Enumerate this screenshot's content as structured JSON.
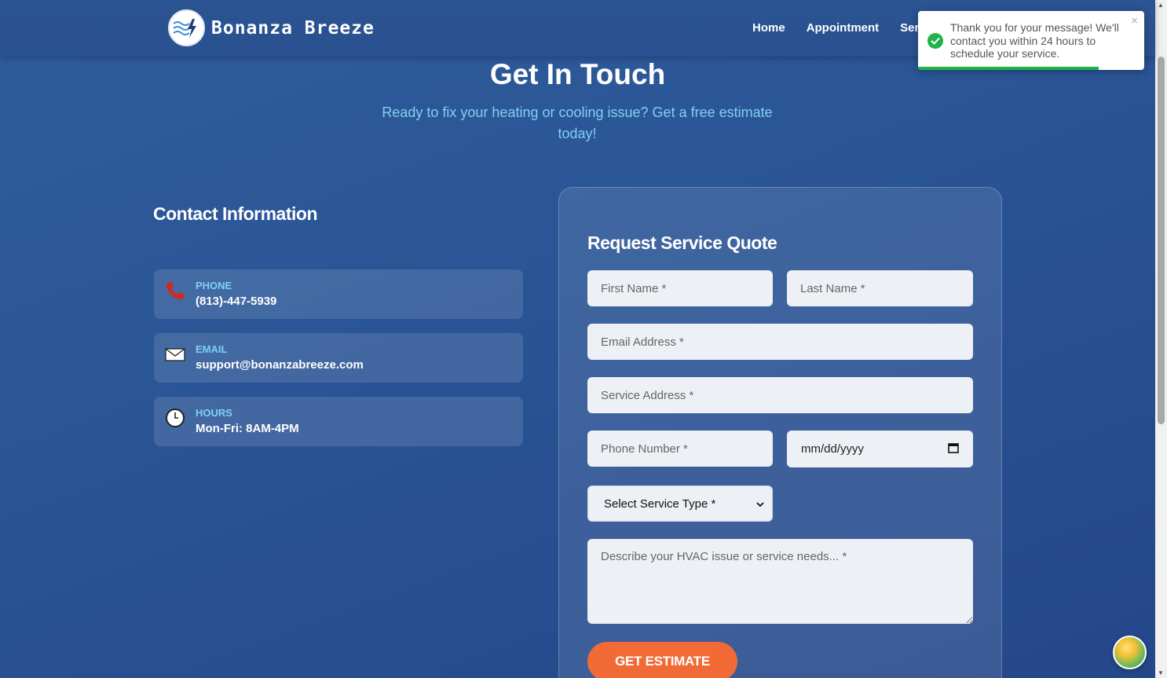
{
  "header": {
    "brand": "Bonanza Breeze",
    "nav": [
      "Home",
      "Appointment",
      "Serv"
    ]
  },
  "hero": {
    "title": "Get In Touch",
    "subtitle": "Ready to fix your heating or cooling issue? Get a free estimate today!"
  },
  "contact": {
    "heading": "Contact Information",
    "items": [
      {
        "label": "PHONE",
        "value": "(813)-447-5939",
        "icon": "phone-icon"
      },
      {
        "label": "EMAIL",
        "value": "support@bonanzabreeze.com",
        "icon": "envelope-icon"
      },
      {
        "label": "HOURS",
        "value": "Mon-Fri: 8AM-4PM",
        "icon": "clock-icon"
      }
    ]
  },
  "form": {
    "heading": "Request Service Quote",
    "first_name_placeholder": "First Name *",
    "last_name_placeholder": "Last Name *",
    "email_placeholder": "Email Address *",
    "address_placeholder": "Service Address *",
    "phone_placeholder": "Phone Number *",
    "date_value": "mm/dd/yyyy",
    "service_type_selected": "Select Service Type *",
    "message_placeholder": "Describe your HVAC issue or service needs... *",
    "submit_label": "GET ESTIMATE"
  },
  "toast": {
    "message": "Thank you for your message! We'll contact you within 24 hours to schedule your service.",
    "close": "×",
    "progress": 0.8
  },
  "colors": {
    "accent": "#f26a35",
    "label": "#7fd0f2",
    "success": "#1fb34a"
  }
}
